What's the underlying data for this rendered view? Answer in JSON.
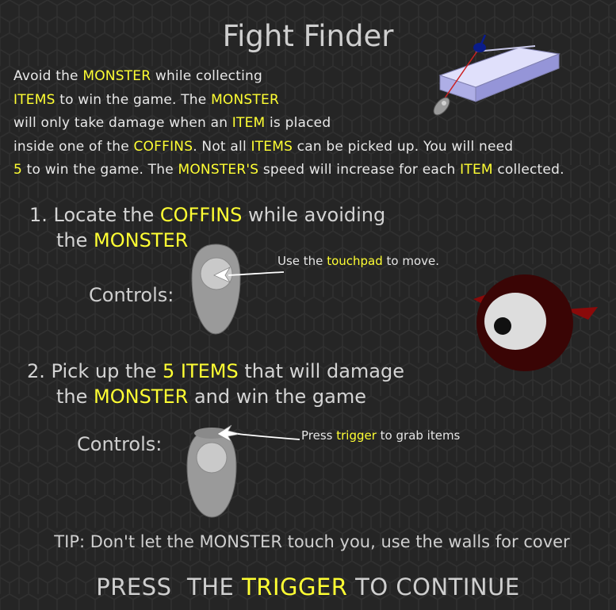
{
  "title": "Fight Finder",
  "intro": {
    "l1": [
      "Avoid the ",
      "MONSTER",
      " while collecting"
    ],
    "l2": [
      "ITEMS",
      " to win the game. The ",
      "MONSTER"
    ],
    "l3": [
      "will only take damage when an ",
      "ITEM",
      " is placed"
    ],
    "l4": [
      "inside one of the ",
      "COFFINS",
      ". Not all ",
      "ITEMS",
      " can be picked up. You will need"
    ],
    "l5": [
      "5",
      " to win the game. The ",
      "MONSTER'S",
      " speed will increase for each ",
      "ITEM",
      " collected."
    ]
  },
  "step1": {
    "number": "1.",
    "a": " Locate the ",
    "b": "COFFINS",
    "c": " while avoiding",
    "d": "the ",
    "e": "MONSTER"
  },
  "step1_controls_label": "Controls:",
  "step1_hint": [
    "Use the ",
    "touchpad",
    " to move."
  ],
  "step2": {
    "number": "2.",
    "a": " Pick up the ",
    "b": "5 ITEMS",
    "c": " that will damage",
    "d": "the ",
    "e": "MONSTER",
    "f": " and win the game"
  },
  "step2_controls_label": "Controls:",
  "step2_hint": [
    "Press ",
    "trigger",
    " to grab items"
  ],
  "tip": "TIP: Don't let the MONSTER touch you, use the walls for cover",
  "press": [
    "PRESS  THE ",
    "TRIGGER",
    " TO CONTINUE"
  ],
  "colors": {
    "highlight": "#ffff33",
    "background": "#262626",
    "text": "#d9d9d9",
    "monster_body": "#3a0505",
    "monster_wing": "#8a0a0a",
    "coffin": "#c8c8f5"
  },
  "icons": {
    "header_art": "vr-controller-pointing-at-coffin-icon",
    "monster": "one-eyed-monster-icon",
    "touchpad_controller": "vr-controller-touchpad-icon",
    "trigger_controller": "vr-controller-trigger-icon"
  }
}
